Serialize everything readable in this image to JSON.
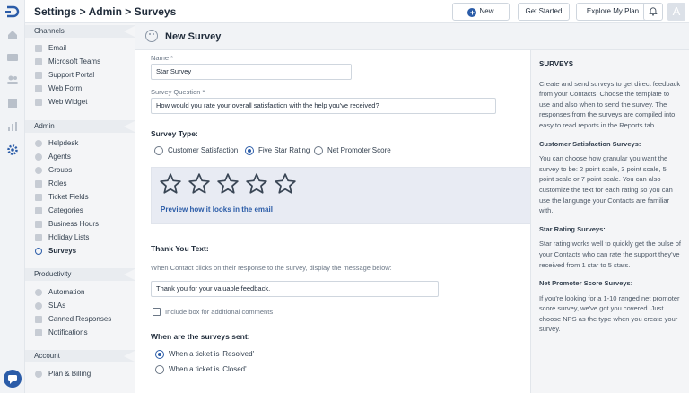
{
  "header": {
    "breadcrumb": "Settings > Admin > Surveys",
    "new_label": "New",
    "get_started_label": "Get Started",
    "explore_label": "Explore My Plan",
    "avatar_initial": "A"
  },
  "sidebar": {
    "sections": [
      {
        "title": "Channels",
        "items": [
          "Email",
          "Microsoft Teams",
          "Support Portal",
          "Web Form",
          "Web Widget"
        ]
      },
      {
        "title": "Admin",
        "items": [
          "Helpdesk",
          "Agents",
          "Groups",
          "Roles",
          "Ticket Fields",
          "Categories",
          "Business Hours",
          "Holiday Lists",
          "Surveys"
        ]
      },
      {
        "title": "Productivity",
        "items": [
          "Automation",
          "SLAs",
          "Canned Responses",
          "Notifications"
        ]
      },
      {
        "title": "Account",
        "items": [
          "Plan & Billing"
        ]
      }
    ],
    "active_item": "Surveys"
  },
  "page": {
    "title": "New Survey",
    "name_label": "Name *",
    "name_value": "Star Survey",
    "question_label": "Survey Question *",
    "question_value": "How would you rate your overall satisfaction with the help you've received?",
    "survey_type_heading": "Survey Type:",
    "survey_types": [
      "Customer Satisfaction",
      "Five Star Rating",
      "Net Promoter Score"
    ],
    "selected_type": "Five Star Rating",
    "star_count": 5,
    "preview_link": "Preview how it looks in the email",
    "thank_you_heading": "Thank You Text:",
    "thank_you_desc": "When Contact clicks on their response to the survey, display the message below:",
    "thank_you_value": "Thank you for your valuable feedback.",
    "include_box_label": "Include box for additional comments",
    "include_box_checked": false,
    "when_sent_heading": "When are the surveys sent:",
    "when_options": [
      "When a ticket is 'Resolved'",
      "When a ticket is 'Closed'"
    ],
    "selected_when": "When a ticket is 'Resolved'"
  },
  "help": {
    "title": "SURVEYS",
    "intro": "Create and send surveys to get direct feedback from your Contacts. Choose the template to use and also when to send the survey. The responses from the surveys are compiled into easy to read reports in the Reports tab.",
    "csat_heading": "Customer Satisfaction Surveys:",
    "csat_text": "You can choose how granular you want the survey to be: 2 point scale, 3 point scale, 5 point scale or 7 point scale. You can also customize the text for each rating so you can use the language your Contacts are familiar with.",
    "star_heading": "Star Rating Surveys:",
    "star_text": "Star rating works well to quickly get the pulse of your Contacts who can rate the support they've received from 1 star to 5 stars.",
    "nps_heading": "Net Promoter Score Surveys:",
    "nps_text": "If you're looking for a 1-10 ranged net promoter score survey, we've got you covered. Just choose NPS as the type when you create your survey."
  },
  "colors": {
    "accent": "#2b5ca8",
    "nav_bg": "#f4f5f7",
    "preview_bg": "#e8ebf3"
  }
}
